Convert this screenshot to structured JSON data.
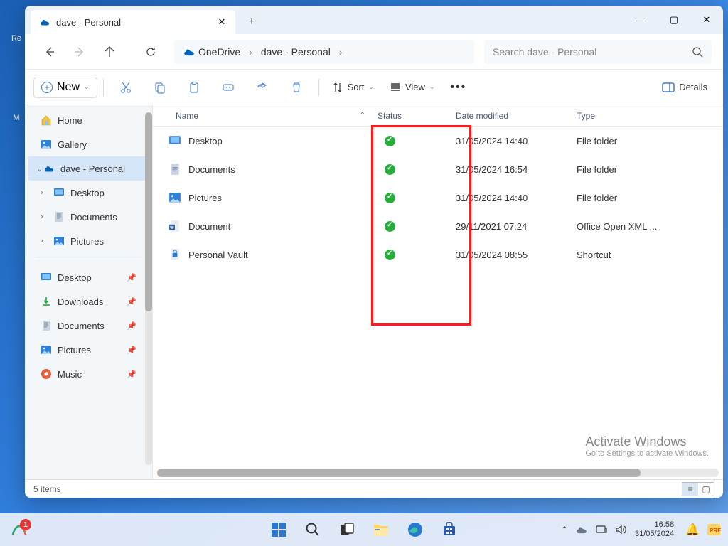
{
  "desktop": {
    "icons": [
      "Re",
      "M"
    ]
  },
  "window": {
    "tab": {
      "title": "dave - Personal"
    },
    "nav": {
      "back": "←",
      "forward": "→",
      "up": "↑",
      "refresh": "⟳"
    },
    "breadcrumb": {
      "root": "OneDrive",
      "current": "dave - Personal"
    },
    "search": {
      "placeholder": "Search dave - Personal"
    },
    "toolbar": {
      "new": "New",
      "sort": "Sort",
      "view": "View",
      "details": "Details"
    },
    "sidebar": {
      "home": "Home",
      "gallery": "Gallery",
      "personal": "dave - Personal",
      "desktop": "Desktop",
      "documents": "Documents",
      "pictures": "Pictures",
      "quick_desktop": "Desktop",
      "quick_downloads": "Downloads",
      "quick_documents": "Documents",
      "quick_pictures": "Pictures",
      "quick_music": "Music"
    },
    "list": {
      "cols": {
        "name": "Name",
        "status": "Status",
        "date": "Date modified",
        "type": "Type"
      },
      "rows": [
        {
          "name": "Desktop",
          "date": "31/05/2024 14:40",
          "type": "File folder",
          "icon": "desktop"
        },
        {
          "name": "Documents",
          "date": "31/05/2024 16:54",
          "type": "File folder",
          "icon": "documents"
        },
        {
          "name": "Pictures",
          "date": "31/05/2024 14:40",
          "type": "File folder",
          "icon": "pictures"
        },
        {
          "name": "Document",
          "date": "29/11/2021 07:24",
          "type": "Office Open XML ...",
          "icon": "docfile"
        },
        {
          "name": "Personal Vault",
          "date": "31/05/2024 08:55",
          "type": "Shortcut",
          "icon": "vault"
        }
      ]
    },
    "watermark": {
      "l1": "Activate Windows",
      "l2": "Go to Settings to activate Windows."
    },
    "status": {
      "items": "5 items"
    }
  },
  "taskbar": {
    "time": "16:58",
    "date": "31/05/2024",
    "badge": "1"
  }
}
